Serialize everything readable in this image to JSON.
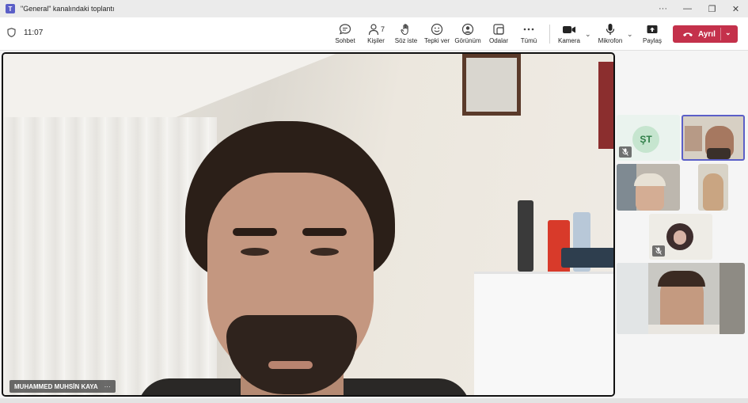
{
  "window": {
    "title": "\"General\" kanalındaki toplantı",
    "more": "···",
    "minimize": "—",
    "maximize": "❐",
    "close": "✕"
  },
  "toolbar": {
    "timer": "11:07",
    "buttons": [
      {
        "id": "chat",
        "label": "Sohbet",
        "icon": "chat-icon"
      },
      {
        "id": "people",
        "label": "Kişiler",
        "icon": "people-icon",
        "count": "7"
      },
      {
        "id": "raise",
        "label": "Söz iste",
        "icon": "hand-icon"
      },
      {
        "id": "react",
        "label": "Tepki ver",
        "icon": "smile-icon"
      },
      {
        "id": "view",
        "label": "Görünüm",
        "icon": "view-icon"
      },
      {
        "id": "rooms",
        "label": "Odalar",
        "icon": "rooms-icon"
      },
      {
        "id": "more",
        "label": "Tümü",
        "icon": "more-icon"
      },
      {
        "id": "camera",
        "label": "Kamera",
        "icon": "camera-icon"
      },
      {
        "id": "mic",
        "label": "Mikrofon",
        "icon": "mic-icon"
      },
      {
        "id": "share",
        "label": "Paylaş",
        "icon": "share-icon"
      }
    ],
    "leave_label": "Ayrıl",
    "chevron": "⌄"
  },
  "main": {
    "speaker_name": "MUHAMMED MUHSİN KAYA",
    "more": "···"
  },
  "gallery": {
    "initials": "ŞT"
  },
  "colors": {
    "brand": "#5b5fc7",
    "leave": "#c4314b",
    "initials_bg": "#c6e5cf",
    "initials_fg": "#2d7d46"
  }
}
